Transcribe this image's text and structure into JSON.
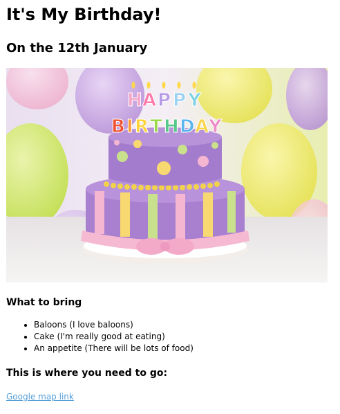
{
  "page": {
    "title": "It's My Birthday!",
    "date_heading": "On the 12th January"
  },
  "hero_image": {
    "alt": "birthday cake",
    "cake_lettering": "HAPPY BIRTHDAY",
    "icon": "birthday-cake-photo"
  },
  "bring": {
    "heading": "What to bring",
    "items": [
      "Baloons (I love baloons)",
      "Cake (I'm really good at eating)",
      "An appetite (There will be lots of food)"
    ]
  },
  "location": {
    "heading": "This is where you need to go:",
    "link_text": "Google map link"
  },
  "colors": {
    "link": "#56a0d8"
  }
}
